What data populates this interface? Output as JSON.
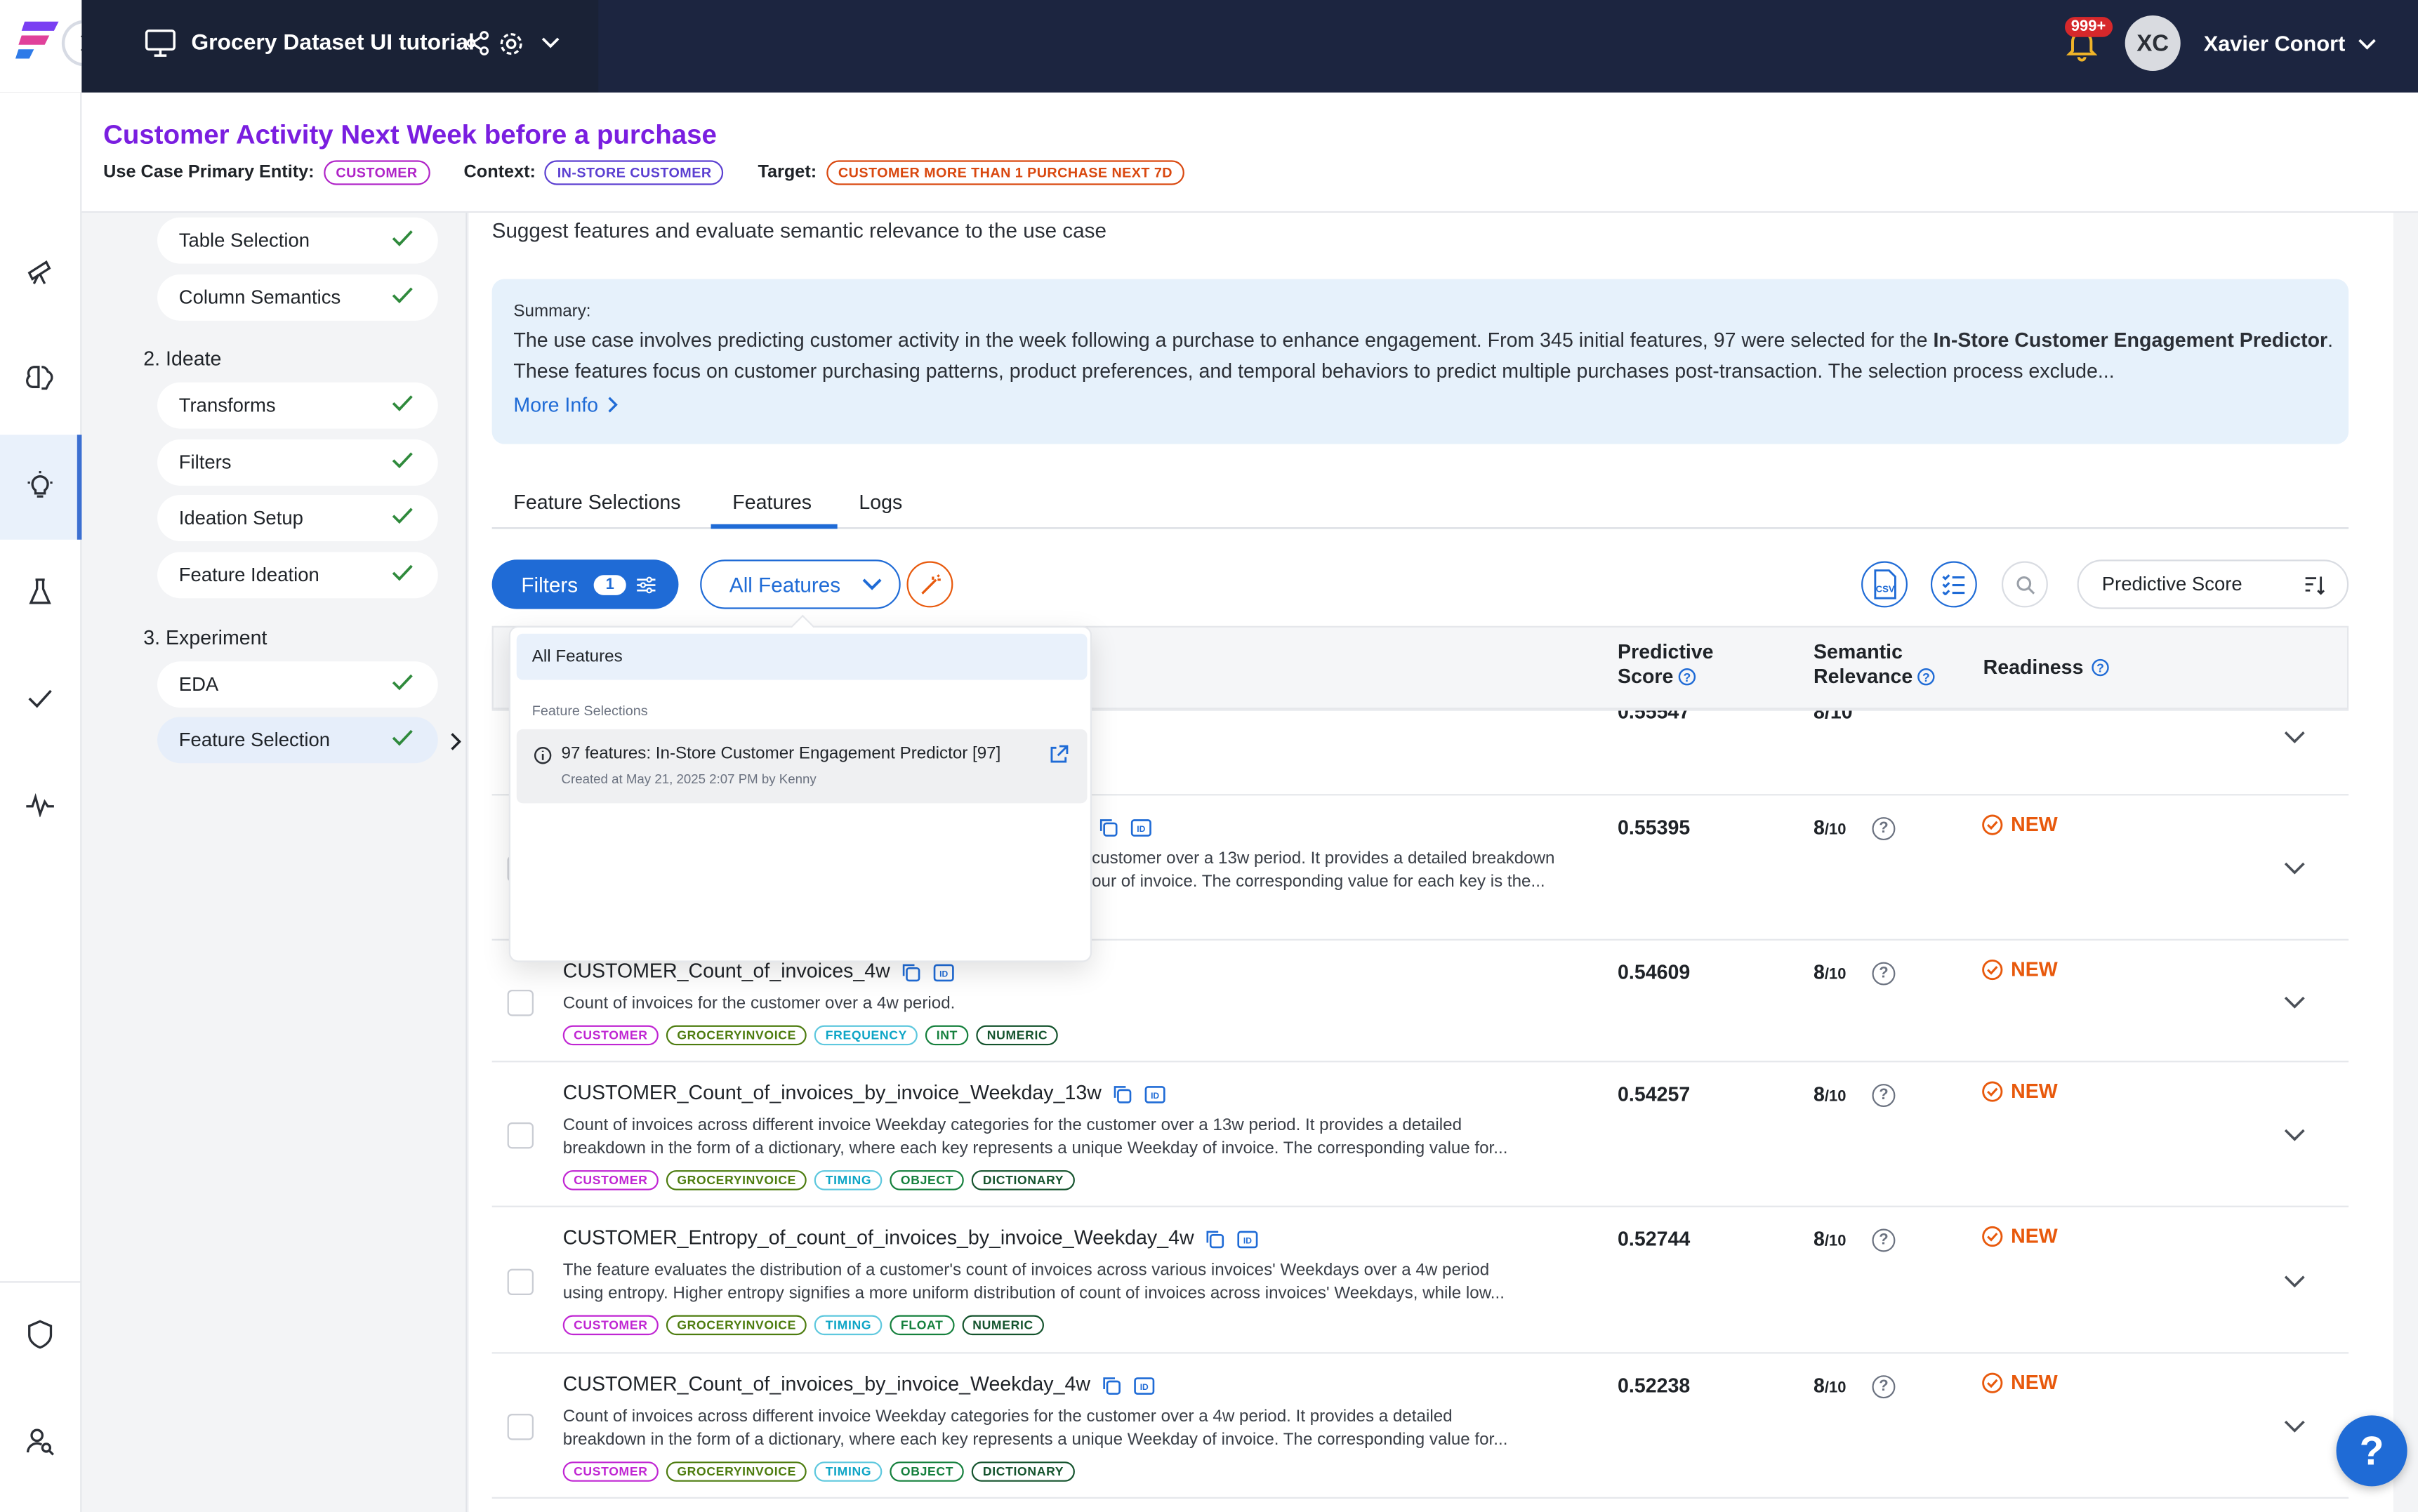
{
  "topbar": {
    "app_title": "Grocery Dataset UI tutorial",
    "notification_count": "999+",
    "user_initials": "XC",
    "user_name": "Xavier Conort"
  },
  "header": {
    "title": "Customer Activity Next Week before a purchase",
    "entity_label": "Use Case Primary Entity:",
    "entity_value": "CUSTOMER",
    "context_label": "Context:",
    "context_value": "IN-STORE CUSTOMER",
    "target_label": "Target:",
    "target_value": "CUSTOMER MORE THAN 1 PURCHASE NEXT 7D"
  },
  "steps": {
    "top_items": [
      "Table Selection",
      "Column Semantics"
    ],
    "ideate_heading": "2. Ideate",
    "ideate_items": [
      "Transforms",
      "Filters",
      "Ideation Setup",
      "Feature Ideation"
    ],
    "experiment_heading": "3. Experiment",
    "experiment_items": [
      "EDA",
      "Feature Selection"
    ]
  },
  "main": {
    "subtitle": "Suggest features and evaluate semantic relevance to the use case",
    "summary_label": "Summary:",
    "summary_pre": "The use case involves predicting customer activity in the week following a purchase to enhance engagement. From 345 initial features, 97 were selected for the ",
    "summary_bold": "In-Store Customer Engagement Predictor",
    "summary_post": ". These features focus on customer purchasing patterns, product preferences, and temporal behaviors to predict multiple purchases post-transaction. The selection process exclude...",
    "more_info": "More Info",
    "tabs": [
      "Feature Selections",
      "Features",
      "Logs"
    ],
    "active_tab": "Features",
    "filters_label": "Filters",
    "filters_count": "1",
    "features_select": "All Features",
    "sort_label": "Predictive Score",
    "csv_label": "CSV"
  },
  "table": {
    "col_score_1": "Predictive",
    "col_score_2": "Score",
    "col_sem_1": "Semantic",
    "col_sem_2": "Relevance",
    "col_ready": "Readiness",
    "partial_score": "0.55547",
    "partial_sem": "8/10"
  },
  "dropdown": {
    "option_all": "All Features",
    "section_label": "Feature Selections",
    "selection_title": "97 features: In-Store Customer Engagement Predictor [97]",
    "selection_meta": "Created at May 21, 2025 2:07 PM by Kenny"
  },
  "rows": [
    {
      "name": "",
      "desc_1": "customer over a 13w period. It provides a detailed breakdown",
      "desc_2": "our of invoice. The corresponding value for each key is the...",
      "score": "0.55395",
      "sem": "8",
      "sem_den": "/10",
      "ready": "NEW",
      "tags": []
    },
    {
      "name": "CUSTOMER_Count_of_invoices_4w",
      "desc_1": "Count of invoices for the customer over a 4w period.",
      "desc_2": "",
      "score": "0.54609",
      "sem": "8",
      "sem_den": "/10",
      "ready": "NEW",
      "tags": [
        "CUSTOMER",
        "GROCERYINVOICE",
        "FREQUENCY",
        "INT",
        "NUMERIC"
      ]
    },
    {
      "name": "CUSTOMER_Count_of_invoices_by_invoice_Weekday_13w",
      "desc_1": "Count of invoices across different invoice Weekday categories for the customer over a 13w period. It provides a detailed",
      "desc_2": "breakdown in the form of a dictionary, where each key represents a unique Weekday of invoice. The corresponding value for...",
      "score": "0.54257",
      "sem": "8",
      "sem_den": "/10",
      "ready": "NEW",
      "tags": [
        "CUSTOMER",
        "GROCERYINVOICE",
        "TIMING",
        "OBJECT",
        "DICTIONARY"
      ]
    },
    {
      "name": "CUSTOMER_Entropy_of_count_of_invoices_by_invoice_Weekday_4w",
      "desc_1": "The feature evaluates the distribution of a customer's count of invoices across various invoices' Weekdays over a 4w period",
      "desc_2": "using entropy. Higher entropy signifies a more uniform distribution of count of invoices across invoices' Weekdays, while low...",
      "score": "0.52744",
      "sem": "8",
      "sem_den": "/10",
      "ready": "NEW",
      "tags": [
        "CUSTOMER",
        "GROCERYINVOICE",
        "TIMING",
        "FLOAT",
        "NUMERIC"
      ]
    },
    {
      "name": "CUSTOMER_Count_of_invoices_by_invoice_Weekday_4w",
      "desc_1": "Count of invoices across different invoice Weekday categories for the customer over a 4w period. It provides a detailed",
      "desc_2": "breakdown in the form of a dictionary, where each key represents a unique Weekday of invoice. The corresponding value for...",
      "score": "0.52238",
      "sem": "8",
      "sem_den": "/10",
      "ready": "NEW",
      "tags": [
        "CUSTOMER",
        "GROCERYINVOICE",
        "TIMING",
        "OBJECT",
        "DICTIONARY"
      ]
    }
  ],
  "help_label": "?",
  "colors": {
    "accent": "#1f6bd6",
    "title_purple": "#7a1ee0",
    "new_orange": "#e8590c",
    "topbar": "#1a2236"
  }
}
